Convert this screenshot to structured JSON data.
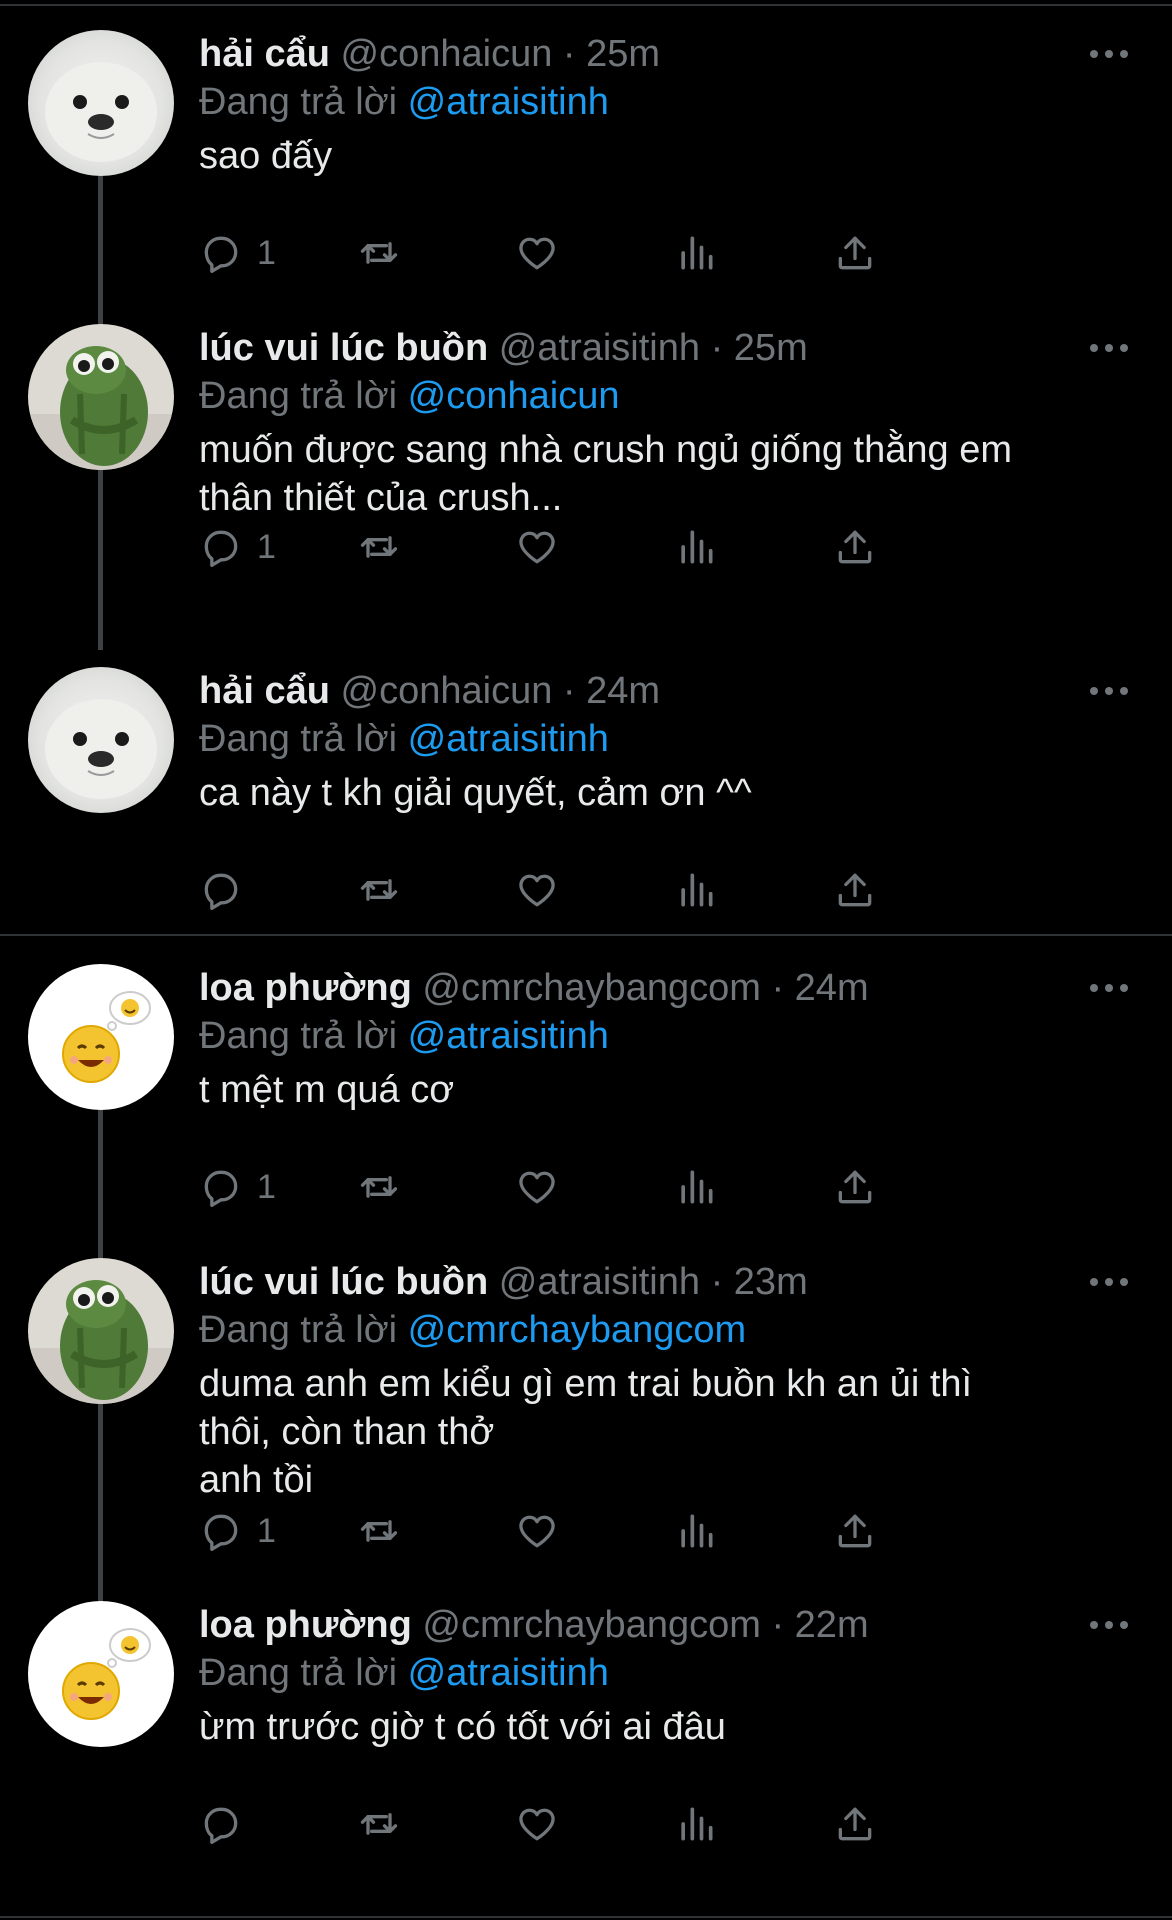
{
  "tweets": [
    {
      "name": "hải cẩu",
      "handle": "@conhaicun",
      "dot": "·",
      "time": "25m",
      "reply_prefix": "Đang trả lời",
      "reply_to": "@atraisitinh",
      "text": "sao đấy",
      "reply_count": "1",
      "avatar": "seal"
    },
    {
      "name": "lúc vui lúc buồn",
      "handle": "@atraisitinh",
      "dot": "·",
      "time": "25m",
      "reply_prefix": "Đang trả lời",
      "reply_to": "@conhaicun",
      "text": "muốn được sang nhà crush ngủ giống thằng em\nthân thiết của crush...",
      "reply_count": "1",
      "avatar": "frog"
    },
    {
      "name": "hải cẩu",
      "handle": "@conhaicun",
      "dot": "·",
      "time": "24m",
      "reply_prefix": "Đang trả lời",
      "reply_to": "@atraisitinh",
      "text": "ca này t kh giải quyết, cảm ơn ^^",
      "reply_count": "",
      "avatar": "seal"
    },
    {
      "name": "loa phường",
      "handle": "@cmrchaybangcom",
      "dot": "·",
      "time": "24m",
      "reply_prefix": "Đang trả lời",
      "reply_to": "@atraisitinh",
      "text": "t mệt m quá cơ",
      "reply_count": "1",
      "avatar": "smiley"
    },
    {
      "name": "lúc vui lúc buồn",
      "handle": "@atraisitinh",
      "dot": "·",
      "time": "23m",
      "reply_prefix": "Đang trả lời",
      "reply_to": "@cmrchaybangcom",
      "text": "duma anh em kiểu gì em trai buồn kh an ủi thì\nthôi, còn than thở\nanh tồi",
      "reply_count": "1",
      "avatar": "frog"
    },
    {
      "name": "loa phường",
      "handle": "@cmrchaybangcom",
      "dot": "·",
      "time": "22m",
      "reply_prefix": "Đang trả lời",
      "reply_to": "@atraisitinh",
      "text": "ừm trước giờ t có tốt với ai đâu",
      "reply_count": "",
      "avatar": "smiley"
    }
  ],
  "icons": {
    "more": "more-horizontal-icon",
    "reply": "reply-bubble-icon",
    "retweet": "retweet-icon",
    "like": "heart-icon",
    "views": "views-bar-chart-icon",
    "share": "share-upload-icon"
  },
  "colors": {
    "background": "#000000",
    "text": "#e7e9ea",
    "muted": "#71767b",
    "mention": "#1d9bf0",
    "divider": "#2f3336"
  }
}
